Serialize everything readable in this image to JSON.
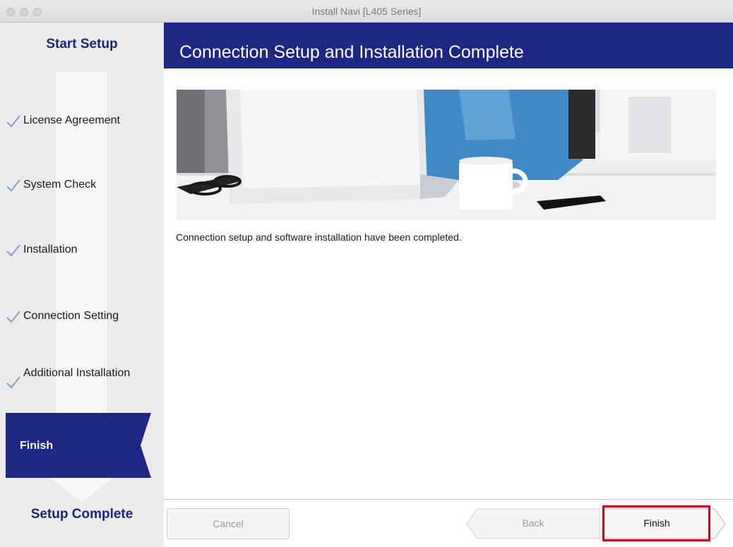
{
  "window": {
    "title": "Install Navi [L405 Series]"
  },
  "sidebar": {
    "header": "Start Setup",
    "steps": [
      {
        "label": "License Agreement",
        "done": true
      },
      {
        "label": "System Check",
        "done": true
      },
      {
        "label": "Installation",
        "done": true
      },
      {
        "label": "Connection Setting",
        "done": true
      },
      {
        "label": "Additional Installation",
        "done": true
      }
    ],
    "current_step": "Finish",
    "footer": "Setup Complete"
  },
  "main": {
    "header": "Connection Setup and Installation Complete",
    "message": "Connection setup and software installation have been completed."
  },
  "buttons": {
    "cancel": "Cancel",
    "back": "Back",
    "finish": "Finish"
  },
  "colors": {
    "brand_blue": "#1c2884",
    "sidebar_bg": "#ebebeb",
    "checkmark": "#6f90c9",
    "highlight_red": "#e0001b"
  }
}
